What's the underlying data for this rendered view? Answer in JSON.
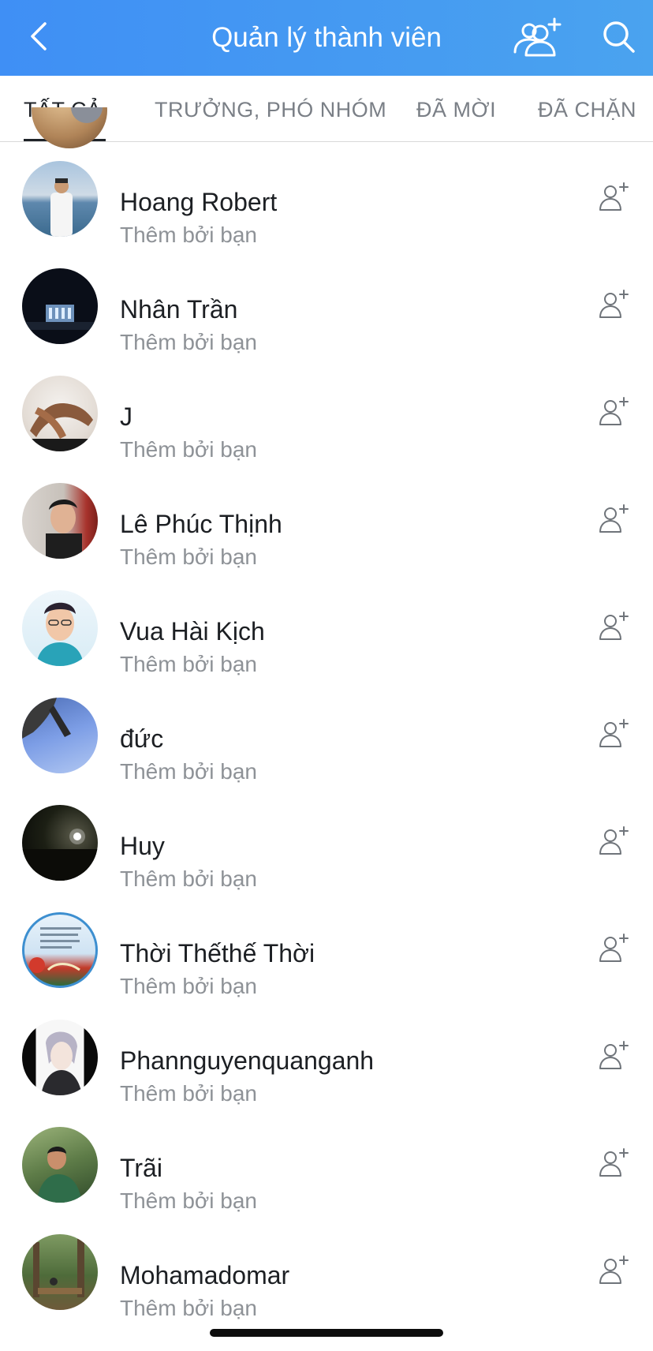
{
  "header": {
    "title": "Quản lý thành viên",
    "back_icon": "chevron-left-icon",
    "add_member_icon": "add-group-member-icon",
    "search_icon": "search-icon",
    "gradient_colors": [
      "#3f8ff5",
      "#4aa3ef"
    ]
  },
  "tabs": [
    {
      "label": "TẤT CẢ",
      "active": true
    },
    {
      "label": "TRƯỞNG, PHÓ NHÓM",
      "active": false
    },
    {
      "label": "ĐÃ MỜI",
      "active": false
    },
    {
      "label": "ĐÃ CHẶN",
      "active": false
    }
  ],
  "members": [
    {
      "name": "Hoang Robert",
      "subtitle": "Thêm bởi bạn"
    },
    {
      "name": "Nhân Trần",
      "subtitle": "Thêm bởi bạn"
    },
    {
      "name": "J",
      "subtitle": "Thêm bởi bạn"
    },
    {
      "name": "Lê Phúc Thịnh",
      "subtitle": "Thêm bởi bạn"
    },
    {
      "name": "Vua Hài Kịch",
      "subtitle": "Thêm bởi bạn"
    },
    {
      "name": "đức",
      "subtitle": "Thêm bởi bạn"
    },
    {
      "name": "Huy",
      "subtitle": "Thêm bởi bạn"
    },
    {
      "name": "Thời Thếthế Thời",
      "subtitle": "Thêm bởi bạn"
    },
    {
      "name": "Phannguyenquanganh",
      "subtitle": "Thêm bởi bạn"
    },
    {
      "name": "Trãi",
      "subtitle": "Thêm bởi bạn"
    },
    {
      "name": "Mohamadomar",
      "subtitle": "Thêm bởi bạn"
    }
  ],
  "row_action_icon": "add-friend-icon",
  "colors": {
    "text_primary": "#1c1f23",
    "text_secondary": "#8e9297",
    "tab_inactive": "#7a7f86"
  }
}
